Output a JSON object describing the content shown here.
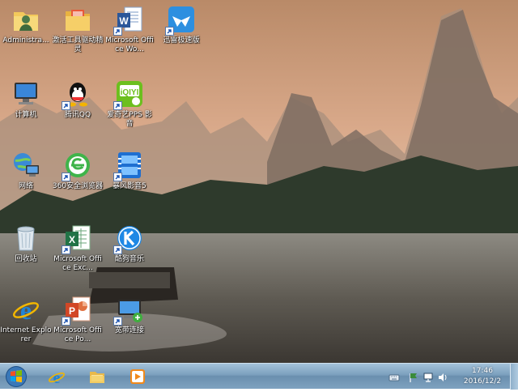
{
  "desktop": {
    "icons": [
      {
        "label": "Administra...",
        "icon": "user-folder-icon"
      },
      {
        "label": "激活工具驱动精灵",
        "icon": "folder-icon"
      },
      {
        "label": "Microsoft Office Wo...",
        "icon": "word-icon"
      },
      {
        "label": "迅雷极速版",
        "icon": "xunlei-icon"
      },
      {
        "label": "计算机",
        "icon": "computer-icon"
      },
      {
        "label": "腾讯QQ",
        "icon": "qq-icon"
      },
      {
        "label": "爱奇艺PPS 影音",
        "icon": "iqiyi-icon"
      },
      {
        "label": "网络",
        "icon": "network-icon"
      },
      {
        "label": "360安全浏览器",
        "icon": "browser-360-icon"
      },
      {
        "label": "暴风影音5",
        "icon": "baofeng-icon"
      },
      {
        "label": "回收站",
        "icon": "recycle-bin-icon"
      },
      {
        "label": "Microsoft Office Exc...",
        "icon": "excel-icon"
      },
      {
        "label": "酷狗音乐",
        "icon": "kugou-icon"
      },
      {
        "label": "Internet Explorer",
        "icon": "ie-icon"
      },
      {
        "label": "Microsoft Office Po...",
        "icon": "powerpoint-icon"
      },
      {
        "label": "宽带连接",
        "icon": "broadband-icon"
      }
    ]
  },
  "taskbar": {
    "start": "start-orb-icon",
    "pinned": [
      "ie-icon",
      "explorer-folder-icon",
      "media-player-icon"
    ],
    "tray": [
      "keyboard-icon",
      "action-center-flag-icon",
      "network-tray-icon",
      "volume-icon"
    ],
    "clock": {
      "time": "17:46",
      "date": "2016/12/2"
    }
  },
  "colors": {
    "sky": "#d9a27a",
    "water": "#6f6a60",
    "taskbar": "#7b9fbd"
  }
}
